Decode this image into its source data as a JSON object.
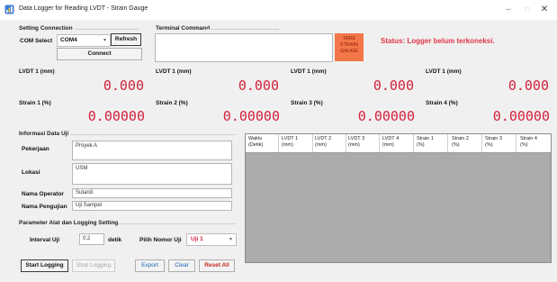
{
  "window": {
    "title": "Data Logger for Reading LVDT - Strain Gauge",
    "minimize": "–",
    "maximize": "□",
    "close": "✕"
  },
  "setting_connection": {
    "title": "Setting Connection",
    "com_label": "COM Select",
    "com_value": "COM4",
    "refresh": "Refresh",
    "connect": "Connect"
  },
  "terminal": {
    "title": "Terminal Command",
    "value": ""
  },
  "tare_button": {
    "line1": "TARE",
    "line2": "STRAIN",
    "line3": "GAUGE"
  },
  "status": "Status: Logger belum terkoneksi.",
  "lvdt": [
    {
      "label": "LVDT 1 (mm)",
      "value": "0.000"
    },
    {
      "label": "LVDT 1 (mm)",
      "value": "0.000"
    },
    {
      "label": "LVDT 1 (mm)",
      "value": "0.000"
    },
    {
      "label": "LVDT 1 (mm)",
      "value": "0.000"
    }
  ],
  "strain": [
    {
      "label": "Strain 1 (%)",
      "value": "0.00000"
    },
    {
      "label": "Strain 2 (%)",
      "value": "0.00000"
    },
    {
      "label": "Strain 3 (%)",
      "value": "0.00000"
    },
    {
      "label": "Strain 4 (%)",
      "value": "0.00000"
    }
  ],
  "info": {
    "title": "Informasi Data Uji",
    "pekerjaan_label": "Pekerjaan",
    "pekerjaan_value": "Proyek A",
    "lokasi_label": "Lokasi",
    "lokasi_value": "USM",
    "operator_label": "Nama Operator",
    "operator_value": "Sutardi",
    "pengujian_label": "Nama Pengujian",
    "pengujian_value": "Uji Sampel"
  },
  "param": {
    "title": "Parameter Alat dan Logging Setting",
    "interval_label": "Interval Uji",
    "interval_value": "0.2",
    "interval_unit": "detik",
    "nomor_label": "Pilih Nomor Uji",
    "nomor_value": "Uji 1"
  },
  "buttons": {
    "start": "Start Logging",
    "stop": "Stop Logging",
    "export": "Export",
    "clear": "Clear",
    "reset": "Reset All"
  },
  "grid": {
    "columns": [
      {
        "l1": "Waktu",
        "l2": "(Detik)"
      },
      {
        "l1": "LVDT 1",
        "l2": "(mm)"
      },
      {
        "l1": "LVDT 2",
        "l2": "(mm)"
      },
      {
        "l1": "LVDT 3",
        "l2": "(mm)"
      },
      {
        "l1": "LVDT 4",
        "l2": "(mm)"
      },
      {
        "l1": "Strain 1",
        "l2": "(%)"
      },
      {
        "l1": "Strain 2",
        "l2": "(%)"
      },
      {
        "l1": "Strain 3",
        "l2": "(%)"
      },
      {
        "l1": "Strain 4",
        "l2": "(%)"
      }
    ]
  },
  "colors": {
    "value_red": "#d3223a",
    "status_red": "#e2364b",
    "tare_orange": "#f37748",
    "grid_bg": "#ababab"
  }
}
